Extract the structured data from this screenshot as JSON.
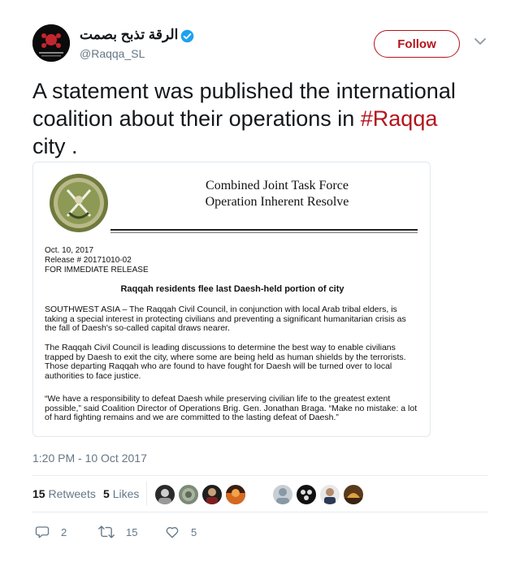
{
  "author": {
    "display_name": "الرقة تذبح بصمت",
    "handle": "@Raqqa_SL",
    "verified": true
  },
  "follow_button": {
    "label": "Follow"
  },
  "tweet": {
    "text_before": "A statement was published the international coalition about their operations in ",
    "hashtag": "#Raqqa",
    "text_after": "city ."
  },
  "media": {
    "org_line1": "Combined Joint Task Force",
    "org_line2": "Operation Inherent Resolve",
    "date": "Oct. 10, 2017",
    "release_no": "Release # 20171010-02",
    "release_note": "FOR IMMEDIATE RELEASE",
    "headline": "Raqqah residents flee last Daesh-held portion of city",
    "paragraphs": [
      "SOUTHWEST ASIA – The Raqqah Civil Council, in conjunction with local Arab tribal elders, is taking a special interest in protecting civilians and preventing a significant humanitarian crisis as the fall of Daesh's so-called capital draws nearer.",
      "The Raqqah Civil Council is leading discussions to determine the best way to enable civilians trapped by Daesh to exit the city, where some are being held as human shields by the terrorists. Those departing Raqqah who are found to have fought for Daesh will be turned over to local authorities to face justice.",
      "“We have a responsibility to defeat Daesh while preserving civilian life to the greatest extent possible,” said Coalition Director of Operations Brig. Gen. Jonathan Braga. “Make no mistake: a lot of hard fighting remains and we are committed to the lasting defeat of Daesh.”"
    ]
  },
  "timestamp": "1:20 PM - 10 Oct 2017",
  "stats": {
    "retweets_count": "15",
    "retweets_label": "Retweets",
    "likes_count": "5",
    "likes_label": "Likes"
  },
  "actions": {
    "reply_count": "2",
    "retweet_count": "15",
    "like_count": "5"
  },
  "colors": {
    "accent": "#b3141c",
    "verified": "#1da1f2",
    "muted": "#657786"
  },
  "icons": [
    "verified-icon",
    "chevron-down-icon",
    "reply-icon",
    "retweet-icon",
    "heart-icon"
  ]
}
